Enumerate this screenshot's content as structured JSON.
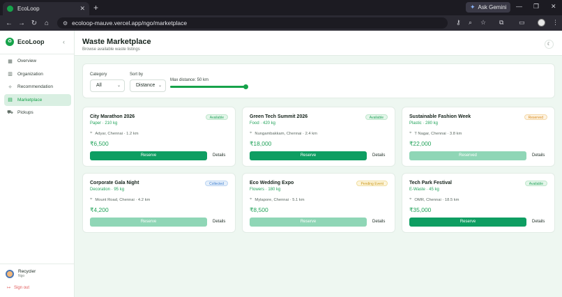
{
  "browser": {
    "tab_title": "EcoLoop",
    "new_tab": "+",
    "gemini_label": "Ask Gemini",
    "url": "ecoloop-mauve.vercel.app/ngo/marketplace"
  },
  "sidebar": {
    "brand": "EcoLoop",
    "items": [
      {
        "label": "Overview",
        "icon": "grid-icon"
      },
      {
        "label": "Organization",
        "icon": "building-icon"
      },
      {
        "label": "Recommendation",
        "icon": "sparkle-icon"
      },
      {
        "label": "Marketplace",
        "icon": "store-icon"
      },
      {
        "label": "Pickups",
        "icon": "truck-icon"
      }
    ],
    "active_index": 3,
    "user": {
      "name": "Recycler",
      "role": "Ngo"
    },
    "signout": "Sign out"
  },
  "header": {
    "title": "Waste Marketplace",
    "subtitle": "Browse available waste listings"
  },
  "filters": {
    "category_label": "Category",
    "category_value": "All",
    "sortby_label": "Sort by",
    "sortby_value": "Distance",
    "distance_label": "Max distance: 50 km",
    "distance_fraction": 1.0
  },
  "listings": [
    {
      "title": "City Marathon 2026",
      "sub": "Paper · 210 kg",
      "location": "Adyar, Chennai · 1.2 km",
      "price": "₹6,500",
      "status": "Available",
      "button": "Reserve",
      "enabled": true,
      "details": "Details"
    },
    {
      "title": "Green Tech Summit 2026",
      "sub": "Food · 420 kg",
      "location": "Nungambakkam, Chennai · 2.4 km",
      "price": "₹18,000",
      "status": "Available",
      "button": "Reserve",
      "enabled": true,
      "details": "Details"
    },
    {
      "title": "Sustainable Fashion Week",
      "sub": "Plastic · 280 kg",
      "location": "T Nagar, Chennai · 3.8 km",
      "price": "₹22,000",
      "status": "Reserved",
      "button": "Reserved",
      "enabled": false,
      "details": "Details"
    },
    {
      "title": "Corporate Gala Night",
      "sub": "Decoration · 95 kg",
      "location": "Mount Road, Chennai · 4.2 km",
      "price": "₹4,200",
      "status": "Collected",
      "button": "Reserve",
      "enabled": false,
      "details": "Details"
    },
    {
      "title": "Eco Wedding Expo",
      "sub": "Flowers · 180 kg",
      "location": "Mylapore, Chennai · 5.1 km",
      "price": "₹8,500",
      "status": "Pending Event",
      "button": "Reserve",
      "enabled": false,
      "details": "Details"
    },
    {
      "title": "Tech Park Festival",
      "sub": "E-Waste · 45 kg",
      "location": "OMR, Chennai · 18.5 km",
      "price": "₹35,000",
      "status": "Available",
      "button": "Reserve",
      "enabled": true,
      "details": "Details"
    }
  ],
  "status_colors": {
    "Available": {
      "bg": "#e4f6ea",
      "fg": "#22a35a",
      "border": "#bfe7cc"
    },
    "Reserved": {
      "bg": "#fdf3e2",
      "fg": "#d98a1c",
      "border": "#f4d8a8"
    },
    "Collected": {
      "bg": "#e6f0fb",
      "fg": "#3b7ccf",
      "border": "#bcd5f2"
    },
    "Pending Event": {
      "bg": "#fdf5dc",
      "fg": "#c99512",
      "border": "#f1dea0"
    }
  }
}
